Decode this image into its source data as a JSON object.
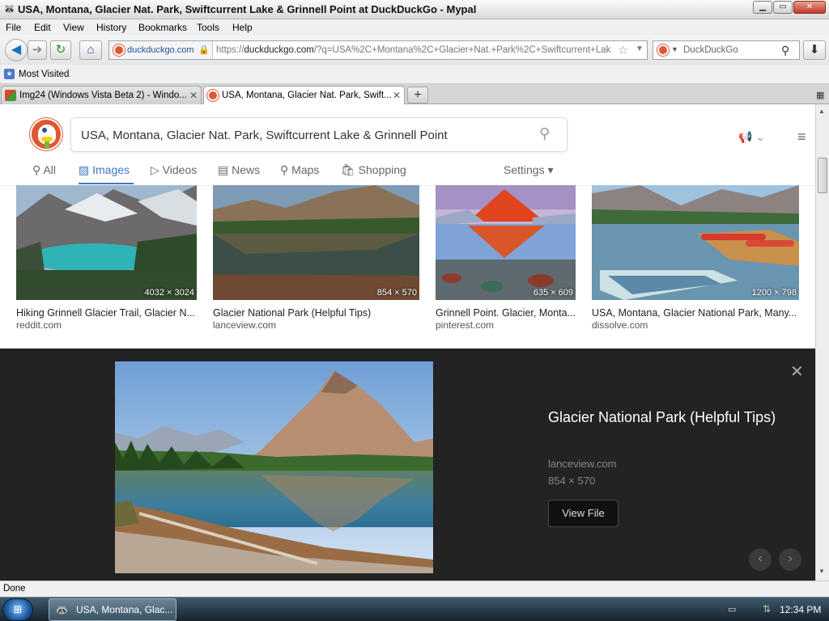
{
  "window": {
    "title": "USA, Montana, Glacier Nat. Park, Swiftcurrent Lake & Grinnell Point at DuckDuckGo - Mypal",
    "title_icon": "raccoon-mypal-icon",
    "minimize": "minimize-icon",
    "maximize": "maximize-icon",
    "close": "close-icon"
  },
  "menu": [
    "File",
    "Edit",
    "View",
    "History",
    "Bookmarks",
    "Tools",
    "Help"
  ],
  "nav": {
    "back_icon": "back-arrow-icon",
    "forward_icon": "forward-arrow-icon",
    "reload_icon": "reload-icon",
    "home_icon": "home-icon",
    "site_host": "duckduckgo.com",
    "url_prefix": "https://",
    "url_domain": "duckduckgo.com",
    "url_rest": "/?q=USA%2C+Montana%2C+Glacier+Nat.+Park%2C+Swiftcurrent+Lak",
    "search_placeholder": "DuckDuckGo",
    "download_icon": "download-arrow-icon"
  },
  "bookmarks": [
    "Most Visited"
  ],
  "tabs": [
    {
      "label": "Img24 (Windows Vista Beta 2) - Windo...",
      "active": false
    },
    {
      "label": "USA, Montana, Glacier Nat. Park, Swift...",
      "active": true
    }
  ],
  "search": {
    "query": "USA, Montana, Glacier Nat. Park, Swiftcurrent Lake & Grinnell Point",
    "tabs": [
      {
        "label": "All",
        "icon": "search-icon"
      },
      {
        "label": "Images",
        "icon": "image-icon"
      },
      {
        "label": "Videos",
        "icon": "play-icon"
      },
      {
        "label": "News",
        "icon": "newspaper-icon"
      },
      {
        "label": "Maps",
        "icon": "map-pin-icon"
      },
      {
        "label": "Shopping",
        "icon": "shopping-bag-icon"
      }
    ],
    "active_tab": "Images",
    "settings_label": "Settings",
    "accent": "#4277c5",
    "brand": "#de5833"
  },
  "results": [
    {
      "title": "Hiking Grinnell Glacier Trail, Glacier N...",
      "source": "reddit.com",
      "dims": "4032 × 3024"
    },
    {
      "title": "Glacier National Park (Helpful Tips)",
      "source": "lanceview.com",
      "dims": "854 × 570"
    },
    {
      "title": "Grinnell Point. Glacier, Monta...",
      "source": "pinterest.com",
      "dims": "635 × 609"
    },
    {
      "title": "USA, Montana, Glacier National Park, Many...",
      "source": "dissolve.com",
      "dims": "1200 × 798"
    }
  ],
  "detail": {
    "title": "Glacier National Park (Helpful Tips)",
    "source": "lanceview.com",
    "dims": "854 × 570",
    "button": "View File",
    "close_icon": "close-icon",
    "prev_icon": "chevron-left-icon",
    "next_icon": "chevron-right-icon"
  },
  "status": "Done",
  "taskbar": {
    "item": "USA, Montana, Glac...",
    "clock": "12:34 PM"
  }
}
